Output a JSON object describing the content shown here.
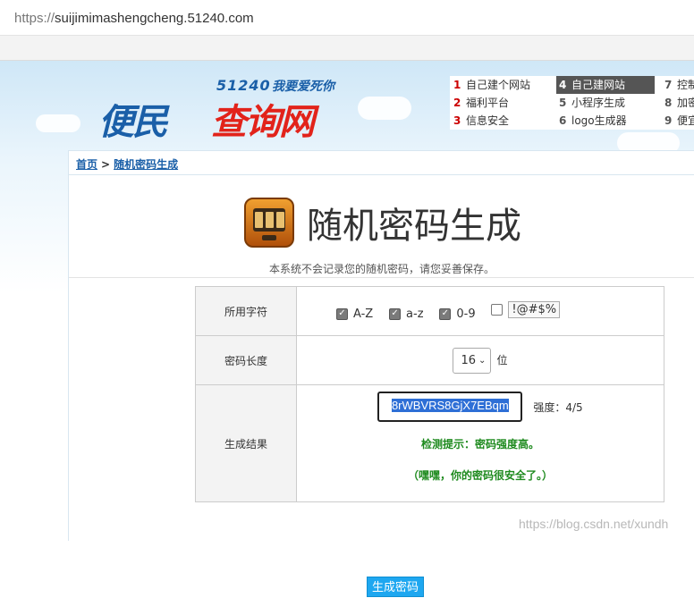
{
  "browser": {
    "url_scheme": "https://",
    "url_host": "suijimimashengcheng.51240.com"
  },
  "logo": {
    "number": "51240",
    "slogan": "我要爱死你",
    "name_a": "便民",
    "name_b": "查询网"
  },
  "topnav": {
    "items": [
      {
        "num": "1",
        "label": "自己建个网站",
        "active": false
      },
      {
        "num": "4",
        "label": "自己建网站",
        "active": true
      },
      {
        "num": "7",
        "label": "控制",
        "active": false
      },
      {
        "num": "2",
        "label": "福利平台",
        "active": false
      },
      {
        "num": "5",
        "label": "小程序生成",
        "active": false
      },
      {
        "num": "8",
        "label": "加密",
        "active": false
      },
      {
        "num": "3",
        "label": "信息安全",
        "active": false
      },
      {
        "num": "6",
        "label": "logo生成器",
        "active": false
      },
      {
        "num": "9",
        "label": "便宜",
        "active": false
      }
    ]
  },
  "breadcrumb": {
    "home": "首页",
    "sep": ">",
    "current": "随机密码生成"
  },
  "page": {
    "title": "随机密码生成",
    "notice": "本系统不会记录您的随机密码，请您妥善保存。"
  },
  "form": {
    "charset_label": "所用字符",
    "charset_options": [
      {
        "label": "A-Z",
        "checked": true
      },
      {
        "label": "a-z",
        "checked": true
      },
      {
        "label": "0-9",
        "checked": true
      }
    ],
    "symbols_checked": false,
    "symbols_value": "!@#$%",
    "length_label": "密码长度",
    "length_value": "16",
    "length_unit": "位",
    "result_label": "生成结果",
    "result_value": "8rWBVRS8GjX7EBqm",
    "strength": "强度：4/5",
    "tip1": "检测提示：密码强度高。",
    "tip2": "（嘿嘿，你的密码很安全了。）",
    "generate_button": "生成密码"
  },
  "watermark": "https://blog.csdn.net/xundh"
}
